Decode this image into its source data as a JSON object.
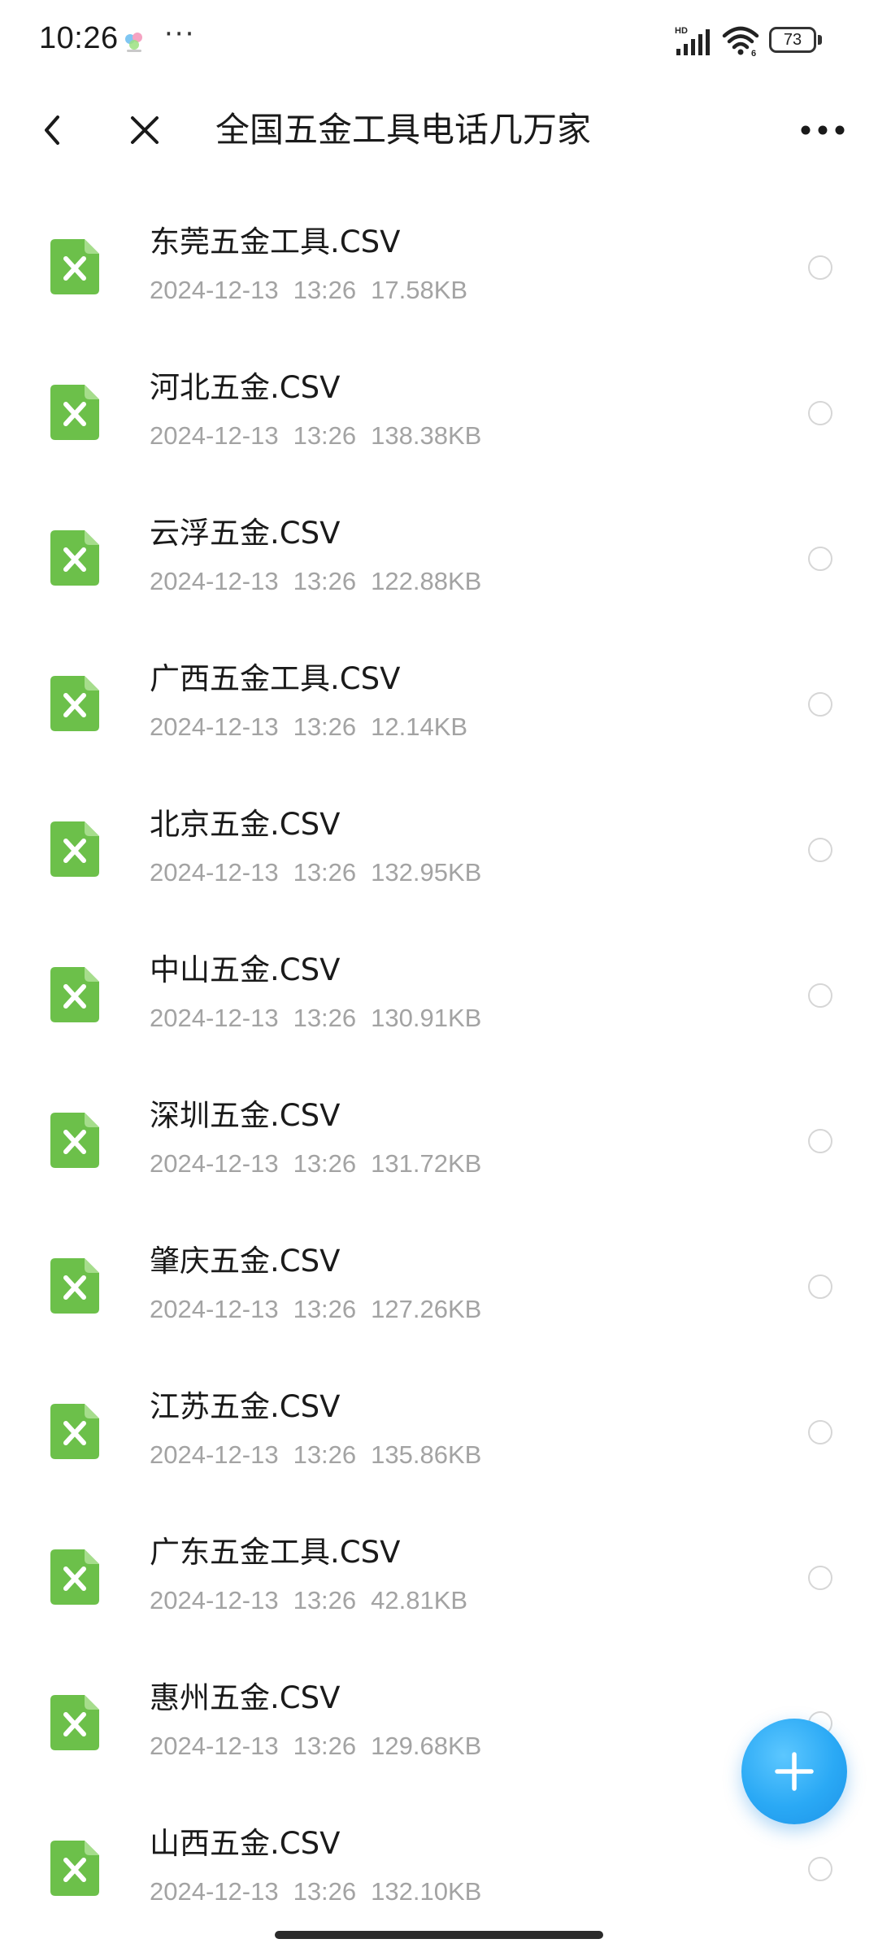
{
  "status_bar": {
    "time": "10:26",
    "dots": "···",
    "hd_label": "HD",
    "wifi_label": "6",
    "battery": "73",
    "app_icon": "notification-app-icon"
  },
  "header": {
    "title": "全国五金工具电话几万家",
    "back_icon": "chevron-left-icon",
    "close_icon": "close-icon",
    "more_icon": "more-horizontal-icon"
  },
  "files": [
    {
      "name": "东莞五金工具.CSV",
      "date": "2024-12-13",
      "time": "13:26",
      "size": "17.58KB"
    },
    {
      "name": "河北五金.CSV",
      "date": "2024-12-13",
      "time": "13:26",
      "size": "138.38KB"
    },
    {
      "name": "云浮五金.CSV",
      "date": "2024-12-13",
      "time": "13:26",
      "size": "122.88KB"
    },
    {
      "name": "广西五金工具.CSV",
      "date": "2024-12-13",
      "time": "13:26",
      "size": "12.14KB"
    },
    {
      "name": "北京五金.CSV",
      "date": "2024-12-13",
      "time": "13:26",
      "size": "132.95KB"
    },
    {
      "name": "中山五金.CSV",
      "date": "2024-12-13",
      "time": "13:26",
      "size": "130.91KB"
    },
    {
      "name": "深圳五金.CSV",
      "date": "2024-12-13",
      "time": "13:26",
      "size": "131.72KB"
    },
    {
      "name": "肇庆五金.CSV",
      "date": "2024-12-13",
      "time": "13:26",
      "size": "127.26KB"
    },
    {
      "name": "江苏五金.CSV",
      "date": "2024-12-13",
      "time": "13:26",
      "size": "135.86KB"
    },
    {
      "name": "广东五金工具.CSV",
      "date": "2024-12-13",
      "time": "13:26",
      "size": "42.81KB"
    },
    {
      "name": "惠州五金.CSV",
      "date": "2024-12-13",
      "time": "13:26",
      "size": "129.68KB"
    },
    {
      "name": "山西五金.CSV",
      "date": "2024-12-13",
      "time": "13:26",
      "size": "132.10KB"
    }
  ],
  "file_icon": "spreadsheet-file-icon",
  "fab_icon": "plus-icon",
  "colors": {
    "file_icon_green": "#6cc04a",
    "fab_blue": "#2aa9f5",
    "meta_gray": "#a3a3a3"
  }
}
